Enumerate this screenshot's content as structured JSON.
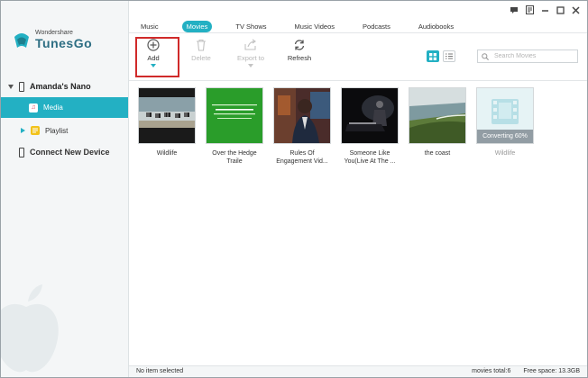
{
  "app": {
    "brand_small": "Wondershare",
    "brand_big": "TunesGo"
  },
  "sidebar": {
    "device_name": "Amanda's Nano",
    "items": [
      {
        "label": "Media",
        "icon": "music-note-icon",
        "selected": true
      },
      {
        "label": "Playlist",
        "icon": "playlist-icon",
        "selected": false
      }
    ],
    "connect_label": "Connect New Device"
  },
  "tabs": [
    {
      "label": "Music",
      "active": false
    },
    {
      "label": "Movies",
      "active": true
    },
    {
      "label": "TV Shows",
      "active": false
    },
    {
      "label": "Music Videos",
      "active": false
    },
    {
      "label": "Podcasts",
      "active": false
    },
    {
      "label": "Audiobooks",
      "active": false
    }
  ],
  "toolbar": {
    "add_label": "Add",
    "delete_label": "Delete",
    "export_label": "Export to",
    "refresh_label": "Refresh"
  },
  "search": {
    "placeholder": "Search Movies"
  },
  "movies": [
    {
      "title": "Wildlife",
      "thumb": "zebras"
    },
    {
      "title": "Over the Hedge Traile",
      "thumb": "green-preview"
    },
    {
      "title": "Rules Of Engagement Vid...",
      "thumb": "speaker"
    },
    {
      "title": "Someone Like You(Live At The ...",
      "thumb": "piano"
    },
    {
      "title": "the coast",
      "thumb": "coast"
    },
    {
      "title": "Wildlife",
      "thumb": "film-placeholder",
      "status": "Converting 60%",
      "progress_percent": 60
    }
  ],
  "status_bar": {
    "selection": "No item selected",
    "total": "movies total:6",
    "free_space": "Free space: 13.3GB"
  },
  "colors": {
    "accent": "#23b0c3",
    "highlight_border": "#d02a2a"
  }
}
